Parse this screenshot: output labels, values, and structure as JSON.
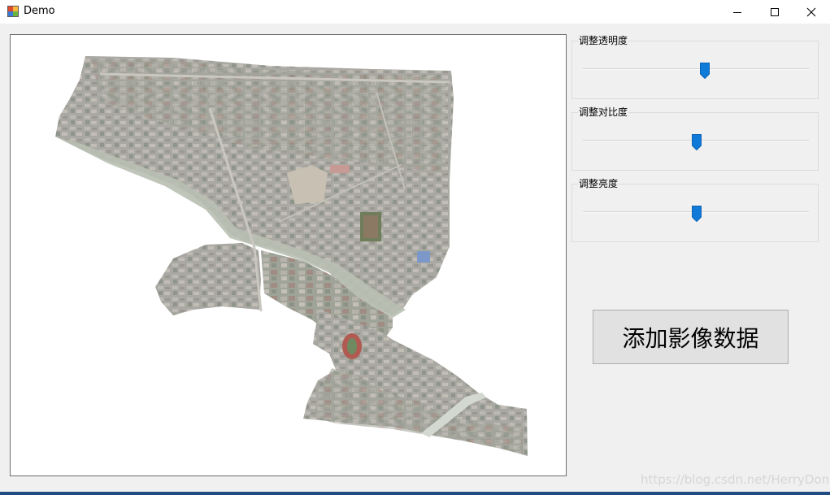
{
  "window": {
    "title": "Demo",
    "icon": "app-form-icon"
  },
  "controls": {
    "minimize_icon": "minimize-icon",
    "maximize_icon": "maximize-icon",
    "close_icon": "close-icon"
  },
  "sliders": [
    {
      "label": "调整透明度",
      "value": 0.54
    },
    {
      "label": "调整对比度",
      "value": 0.5
    },
    {
      "label": "调整亮度",
      "value": 0.5
    }
  ],
  "add_button": {
    "label": "添加影像数据"
  },
  "watermark": "https://blog.csdn.net/HerryDong",
  "colors": {
    "accent": "#0078d7",
    "thumb": "#0f7ad8",
    "bottom_border": "#1f4d82"
  }
}
